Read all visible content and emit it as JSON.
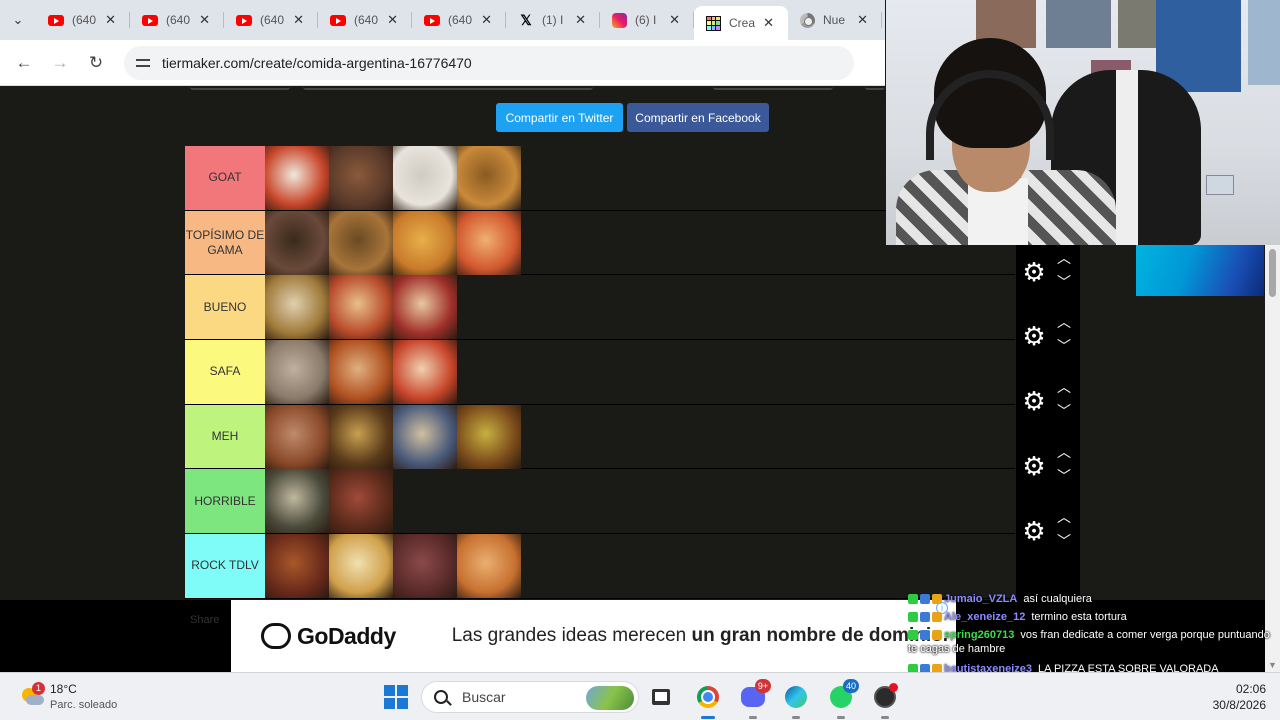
{
  "browser": {
    "tabs": [
      {
        "icon": "youtube-icon",
        "label": "(640",
        "active": false
      },
      {
        "icon": "youtube-icon",
        "label": "(640",
        "active": false
      },
      {
        "icon": "youtube-icon",
        "label": "(640",
        "active": false
      },
      {
        "icon": "youtube-icon",
        "label": "(640",
        "active": false
      },
      {
        "icon": "youtube-icon",
        "label": "(640",
        "active": false
      },
      {
        "icon": "x-icon",
        "label": "(1) I",
        "active": false
      },
      {
        "icon": "instagram-icon",
        "label": "(6) I",
        "active": false
      },
      {
        "icon": "tiermaker-icon",
        "label": "Crea",
        "active": true
      },
      {
        "icon": "chrome-icon",
        "label": "Nue",
        "active": false
      }
    ],
    "url": "tiermaker.com/create/comida-argentina-16776470"
  },
  "share": {
    "twitter_label": "Compartir en Twitter",
    "facebook_label": "Compartir en Facebook"
  },
  "tiers": [
    {
      "label": "GOAT",
      "color": "#f2777a",
      "items": 4
    },
    {
      "label": "TOPÍSIMO DE GAMA",
      "color": "#f7b883",
      "items": 4
    },
    {
      "label": "BUENO",
      "color": "#fbd982",
      "items": 3
    },
    {
      "label": "SAFA",
      "color": "#fcf97f",
      "items": 3
    },
    {
      "label": "MEH",
      "color": "#bef47e",
      "items": 4
    },
    {
      "label": "HORRIBLE",
      "color": "#7de67f",
      "items": 2
    },
    {
      "label": "ROCK TDLV",
      "color": "#7ffcf8",
      "items": 4
    }
  ],
  "ad": {
    "brand": "GoDaddy",
    "text_prefix": "Las grandes ideas merecen ",
    "text_bold": "un gran nombre de dominio.",
    "ghost_text": "Share"
  },
  "chat": [
    {
      "user": "Jumaio_VZLA",
      "user_color": "#8b8bff",
      "message": "así cualquiera"
    },
    {
      "user": "Ale_xeneize_12",
      "user_color": "#8b8bff",
      "message": "termino esta tortura"
    },
    {
      "user": "spring260713",
      "user_color": "#3ddc4a",
      "message": "vos fran dedicate a comer verga porque puntuando te cagas de hambre"
    },
    {
      "user": "bautistaxeneize3",
      "user_color": "#8b8bff",
      "message": "LA PIZZA ESTA SOBRE VALORADA"
    }
  ],
  "taskbar": {
    "weather_temp": "18°C",
    "weather_desc": "Parc. soleado",
    "weather_badge": "1",
    "search_placeholder": "Buscar",
    "discord_badge": "9+",
    "whatsapp_badge": "40",
    "time": "02:06",
    "date": "30/8/2026"
  }
}
